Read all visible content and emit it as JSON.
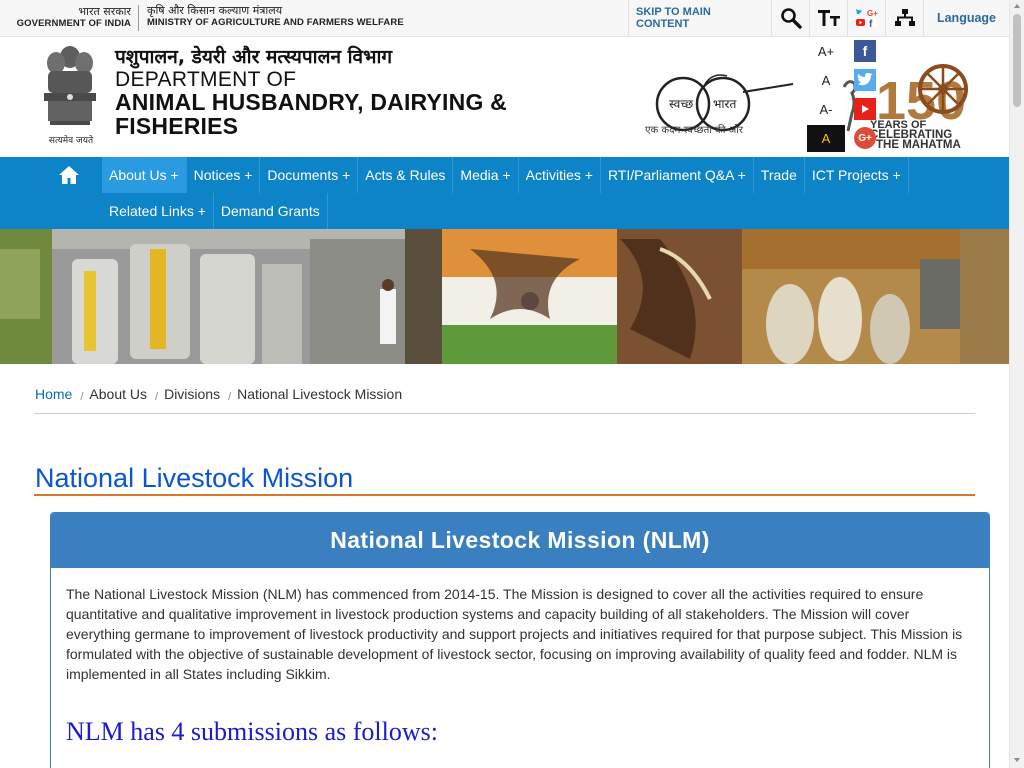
{
  "topbar": {
    "gov_hindi": "भारत सरकार",
    "gov_english": "GOVERNMENT OF INDIA",
    "ministry_hindi": "कृषि और किसान कल्याण मंत्रालय",
    "ministry_english": "MINISTRY OF AGRICULTURE AND FARMERS WELFARE",
    "skip_label": "SKIP TO MAIN CONTENT",
    "language_label": "Language",
    "icons": [
      "search-icon",
      "text-size-icon",
      "social-media-icon",
      "sitemap-icon"
    ]
  },
  "header": {
    "dept_hindi": "पशुपालन, डेयरी और मत्स्यपालन विभाग",
    "dept_line1": "DEPARTMENT OF",
    "dept_line2": "ANIMAL HUSBANDRY, DAIRYING & FISHERIES",
    "emblem_caption": "सत्यमेव जयते",
    "swachh_left": "स्वच्छ",
    "swachh_right": "भारत",
    "swachh_tagline": "एक कदम स्वच्छता की ओर",
    "font_buttons": [
      "A+",
      "A",
      "A-",
      "A"
    ],
    "social": [
      "facebook-icon",
      "twitter-icon",
      "youtube-icon",
      "google-plus-icon"
    ],
    "gandhi_number": "150",
    "gandhi_line1": "YEARS OF",
    "gandhi_line2": "CELEBRATING",
    "gandhi_line3": "THE MAHATMA"
  },
  "nav": {
    "row1": [
      "About Us +",
      "Notices +",
      "Documents +",
      "Acts & Rules",
      "Media +",
      "Activities +",
      "RTI/Parliament Q&A +",
      "Trade",
      "ICT Projects +"
    ],
    "row2": [
      "Related Links +",
      "Demand Grants"
    ],
    "active": "About Us +"
  },
  "breadcrumb": [
    "Home",
    "About Us",
    "Divisions",
    "National Livestock Mission"
  ],
  "page": {
    "title": "National Livestock Mission",
    "panel_title": "National Livestock Mission (NLM)",
    "paragraph": "The National Livestock Mission (NLM) has commenced from 2014-15. The Mission is designed to cover all the activities required to ensure quantitative and qualitative improvement in livestock production systems and capacity building of all stakeholders. The Mission will cover everything germane to improvement of livestock productivity and support projects and initiatives required for that purpose subject. This Mission is formulated with the objective of sustainable development of livestock sector, focusing on improving availability of quality feed and fodder. NLM is implemented in all States including Sikkim.",
    "subheading": "NLM has 4 submissions as follows:"
  },
  "colors": {
    "nav_bg": "#0d84c8",
    "nav_active": "#2a9be0",
    "panel_head": "#3a7fc0",
    "title_blue": "#0a55d3",
    "title_rule": "#d2792a",
    "subheading": "#1a1ad0"
  }
}
